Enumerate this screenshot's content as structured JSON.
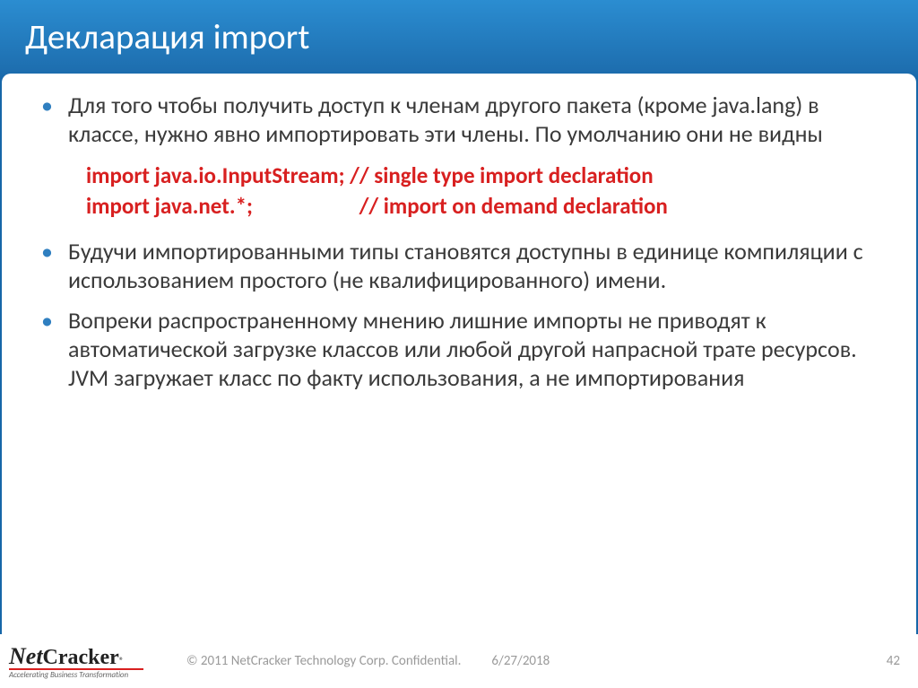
{
  "title": "Декларация import",
  "bullets": {
    "b1": "Для того чтобы получить доступ к членам другого пакета (кроме java.lang) в классе, нужно явно импортировать эти члены. По умолчанию они не видны",
    "b2": "Будучи импортированными типы становятся доступны в единице компиляции с использованием простого (не квалифицированного) имени.",
    "b3": "Вопреки распространенному мнению лишние импорты не приводят к автоматической загрузке классов или любой другой напрасной трате ресурсов. JVM загружает класс по факту использования, а не импортирования"
  },
  "code": "import java.io.InputStream; // single type import declaration\nimport java.net.*;                     // import on demand declaration",
  "footer": {
    "logo_net": "Net",
    "logo_cracker": "Cracker",
    "logo_reg": "®",
    "logo_tag": "Accelerating Business Transformation",
    "copyright": "© 2011 NetCracker Technology Corp. Confidential.",
    "date": "6/27/2018",
    "page": "42"
  }
}
